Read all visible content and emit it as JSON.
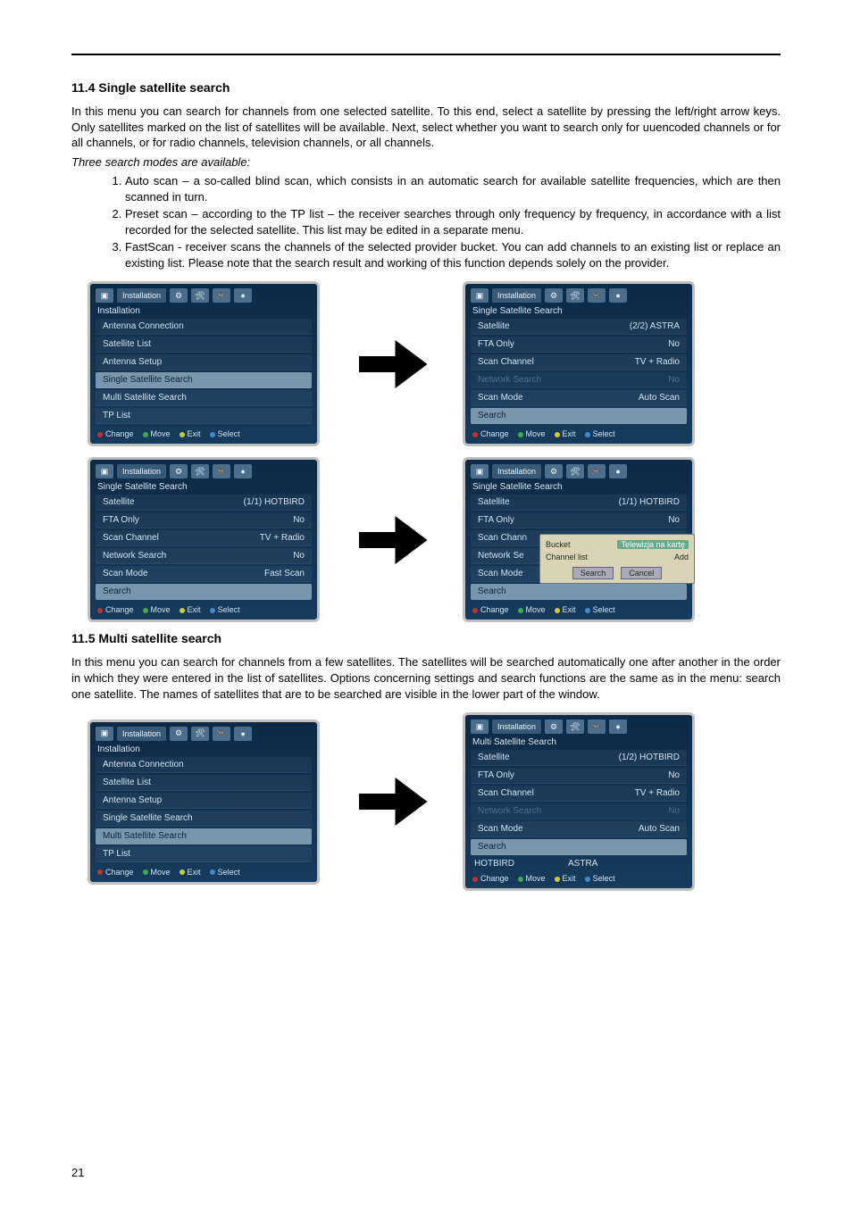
{
  "section1": {
    "heading": "11.4 Single satellite search",
    "para1": "In this menu you can search for channels from one selected satellite. To this end, select a satellite by pressing the left/right arrow keys.  Only satellites marked on the list of satellites will be available. Next, select whether you want to search only for uuencoded channels or for all channels, or for radio channels, television channels, or all channels.",
    "para2_italic": "Three search modes are available:",
    "list": [
      "Auto scan – a so-called blind scan, which consists in an automatic search for available satellite frequencies, which are then scanned in turn.",
      "Preset scan – according to the TP list – the receiver searches through only frequency by frequency, in accordance with a list recorded for the selected satellite. This list may be edited in a separate menu.",
      "FastScan - receiver scans the channels of the selected provider bucket. You can add channels to an existing list or replace an existing list. Please note that the search result and working of this function depends solely on the provider."
    ]
  },
  "section2": {
    "heading": "11.5 Multi satellite search",
    "para1": "In this menu you can search for channels from a few satellites. The satellites will be searched automatically one after another in the order in which they were entered in the list of satellites. Options concerning settings and search functions are the same as in the menu: search one satellite. The names of satellites that are to be searched are visible in the lower part of the window."
  },
  "tv": {
    "tab_label": "Installation",
    "title_installation": "Installation",
    "title_single": "Single Satellite Search",
    "title_multi": "Multi Satellite Search",
    "menu_install": [
      "Antenna Connection",
      "Satellite List",
      "Antenna Setup",
      "Single Satellite Search",
      "Multi Satellite Search",
      "TP List"
    ],
    "box2": {
      "rows": [
        {
          "l": "Satellite",
          "r": "(2/2) ASTRA"
        },
        {
          "l": "FTA Only",
          "r": "No"
        },
        {
          "l": "Scan Channel",
          "r": "TV + Radio"
        },
        {
          "l": "Network Search",
          "r": "No",
          "dim": true
        },
        {
          "l": "Scan Mode",
          "r": "Auto Scan"
        },
        {
          "l": "Search",
          "r": "",
          "sel": true
        }
      ]
    },
    "box3": {
      "rows": [
        {
          "l": "Satellite",
          "r": "(1/1) HOTBIRD"
        },
        {
          "l": "FTA Only",
          "r": "No"
        },
        {
          "l": "Scan Channel",
          "r": "TV + Radio"
        },
        {
          "l": "Network Search",
          "r": "No"
        },
        {
          "l": "Scan Mode",
          "r": "Fast Scan"
        },
        {
          "l": "Search",
          "r": "",
          "sel": true
        }
      ]
    },
    "box4": {
      "rows": [
        {
          "l": "Satellite",
          "r": "(1/1) HOTBIRD"
        },
        {
          "l": "FTA Only",
          "r": "No"
        },
        {
          "l": "Scan Chann",
          "r": ""
        },
        {
          "l": "Network Se",
          "r": ""
        },
        {
          "l": "Scan Mode",
          "r": ""
        },
        {
          "l": "Search",
          "r": "",
          "sel": true
        }
      ],
      "popup": {
        "bucket_l": "Bucket",
        "bucket_r": "Telewizja na kartę",
        "chan_l": "Channel list",
        "chan_r": "Add",
        "btn1": "Search",
        "btn2": "Cancel"
      }
    },
    "box6": {
      "rows": [
        {
          "l": "Satellite",
          "r": "(1/2) HOTBIRD"
        },
        {
          "l": "FTA Only",
          "r": "No"
        },
        {
          "l": "Scan Channel",
          "r": "TV + Radio"
        },
        {
          "l": "Network Search",
          "r": "No",
          "dim": true
        },
        {
          "l": "Scan Mode",
          "r": "Auto Scan"
        },
        {
          "l": "Search",
          "r": "",
          "sel": true
        }
      ],
      "sats": [
        "HOTBIRD",
        "ASTRA"
      ]
    },
    "legend": {
      "change": "Change",
      "move": "Move",
      "exit": "Exit",
      "select": "Select"
    }
  },
  "page_number": "21"
}
